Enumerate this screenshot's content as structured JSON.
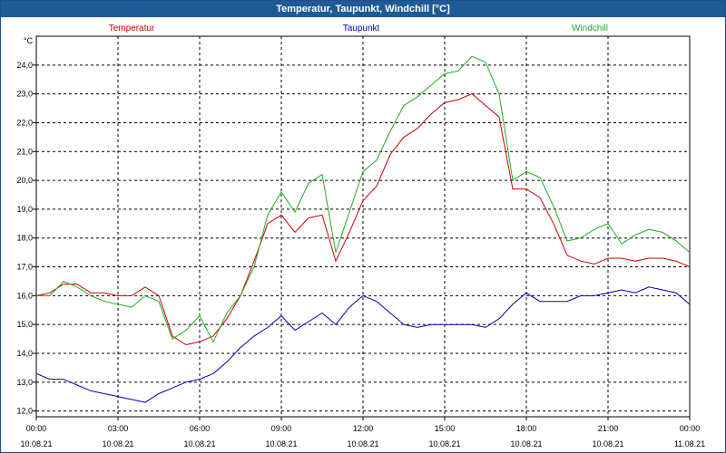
{
  "window": {
    "title": "Temperatur, Taupunkt, Windchill [°C]"
  },
  "chart_data": {
    "type": "line",
    "title": "Temperatur, Taupunkt, Windchill [°C]",
    "ylabel": "°C",
    "ylim": [
      11.8,
      25.0
    ],
    "xlim": [
      "10.08.21 00:00",
      "11.08.21 00:00"
    ],
    "grid": true,
    "legend_position": "top",
    "y_ticks": [
      "12,0",
      "13,0",
      "14,0",
      "15,0",
      "16,0",
      "17,0",
      "18,0",
      "19,0",
      "20,0",
      "21,0",
      "22,0",
      "23,0",
      "24,0"
    ],
    "x_ticks": [
      {
        "time": "00:00",
        "date": "10.08.21"
      },
      {
        "time": "03:00",
        "date": "10.08.21"
      },
      {
        "time": "06:00",
        "date": "10.08.21"
      },
      {
        "time": "09:00",
        "date": "10.08.21"
      },
      {
        "time": "12:00",
        "date": "10.08.21"
      },
      {
        "time": "15:00",
        "date": "10.08.21"
      },
      {
        "time": "18:00",
        "date": "10.08.21"
      },
      {
        "time": "21:00",
        "date": "10.08.21"
      },
      {
        "time": "00:00",
        "date": "11.08.21"
      }
    ],
    "x": [
      "00:00",
      "00:30",
      "01:00",
      "01:30",
      "02:00",
      "02:30",
      "03:00",
      "03:30",
      "04:00",
      "04:30",
      "05:00",
      "05:30",
      "06:00",
      "06:30",
      "07:00",
      "07:30",
      "08:00",
      "08:30",
      "09:00",
      "09:30",
      "10:00",
      "10:30",
      "11:00",
      "11:30",
      "12:00",
      "12:30",
      "13:00",
      "13:30",
      "14:00",
      "14:30",
      "15:00",
      "15:30",
      "16:00",
      "16:30",
      "17:00",
      "17:30",
      "18:00",
      "18:30",
      "19:00",
      "19:30",
      "20:00",
      "20:30",
      "21:00",
      "21:30",
      "22:00",
      "22:30",
      "23:00",
      "23:30",
      "24:00"
    ],
    "series": [
      {
        "name": "Temperatur",
        "color": "#cc0000",
        "values": [
          16.0,
          16.1,
          16.4,
          16.4,
          16.1,
          16.1,
          16.0,
          16.0,
          16.3,
          16.0,
          14.6,
          14.3,
          14.4,
          14.6,
          15.2,
          16.0,
          17.2,
          18.5,
          18.8,
          18.2,
          18.7,
          18.8,
          17.2,
          18.2,
          19.3,
          19.8,
          20.9,
          21.5,
          21.8,
          22.3,
          22.7,
          22.8,
          23.0,
          22.6,
          22.2,
          19.7,
          19.7,
          19.4,
          18.5,
          17.4,
          17.2,
          17.1,
          17.3,
          17.3,
          17.2,
          17.3,
          17.3,
          17.2,
          17.0
        ]
      },
      {
        "name": "Taupunkt",
        "color": "#0000bb",
        "values": [
          13.3,
          13.1,
          13.1,
          12.9,
          12.7,
          12.6,
          12.5,
          12.4,
          12.3,
          12.6,
          12.8,
          13.0,
          13.1,
          13.3,
          13.7,
          14.2,
          14.6,
          14.9,
          15.3,
          14.8,
          15.1,
          15.4,
          15.0,
          15.6,
          16.0,
          15.8,
          15.4,
          15.0,
          14.9,
          15.0,
          15.0,
          15.0,
          15.0,
          14.9,
          15.2,
          15.7,
          16.1,
          15.8,
          15.8,
          15.8,
          16.0,
          16.0,
          16.1,
          16.2,
          16.1,
          16.3,
          16.2,
          16.1,
          15.7
        ]
      },
      {
        "name": "Windchill",
        "color": "#22aa22",
        "values": [
          16.0,
          16.0,
          16.5,
          16.3,
          16.0,
          15.8,
          15.7,
          15.6,
          16.0,
          15.8,
          14.5,
          14.8,
          15.3,
          14.4,
          15.4,
          16.0,
          17.0,
          18.8,
          19.6,
          18.9,
          19.9,
          20.2,
          17.5,
          18.9,
          20.3,
          20.7,
          21.7,
          22.6,
          22.9,
          23.3,
          23.7,
          23.8,
          24.3,
          24.1,
          23.0,
          20.0,
          20.3,
          20.1,
          19.1,
          17.9,
          18.0,
          18.3,
          18.5,
          17.8,
          18.1,
          18.3,
          18.2,
          17.9,
          17.5
        ]
      }
    ]
  }
}
